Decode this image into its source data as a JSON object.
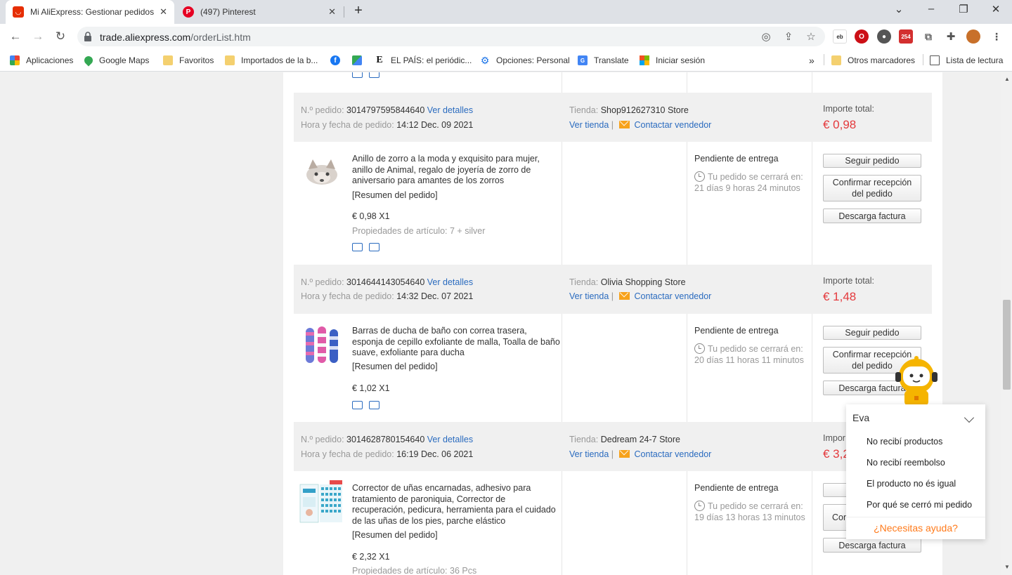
{
  "browser": {
    "tabs": [
      {
        "title": "Mi AliExpress: Gestionar pedidos",
        "icon": "aliexpress-icon",
        "active": true
      },
      {
        "title": "(497) Pinterest",
        "icon": "pinterest-icon",
        "active": false
      }
    ],
    "url_domain": "trade.aliexpress.com",
    "url_path": "/orderList.htm",
    "extension_badge": "254",
    "bookmarks": [
      {
        "label": "Aplicaciones",
        "icon": "apps-grid-icon"
      },
      {
        "label": "Google Maps",
        "icon": "google-maps-icon"
      },
      {
        "label": "Favoritos",
        "icon": "folder-icon"
      },
      {
        "label": "Importados de la b...",
        "icon": "folder-icon"
      },
      {
        "label": "",
        "icon": "facebook-icon"
      },
      {
        "label": "",
        "icon": "maps-icon"
      },
      {
        "label": "EL PAÍS: el periódic...",
        "icon": "el-pais-icon"
      },
      {
        "label": "Opciones: Personal",
        "icon": "gear-icon"
      },
      {
        "label": "Translate",
        "icon": "translate-icon"
      },
      {
        "label": "Iniciar sesión",
        "icon": "microsoft-icon"
      }
    ],
    "bookmarks_overflow": "»",
    "other_bookmarks": "Otros marcadores",
    "reading_list": "Lista de lectura"
  },
  "labels": {
    "order_no": "N.º pedido:",
    "details": "Ver detalles",
    "datetime": "Hora y fecha de pedido:",
    "store": "Tienda:",
    "view_store": "Ver tienda",
    "separator": "|",
    "contact_seller": "Contactar vendedor",
    "total": "Importe total:",
    "summary": "[Resumen del pedido]",
    "props_prefix": "Propiedades de artículo:",
    "pending": "Pendiente de entrega",
    "track": "Seguir pedido",
    "confirm": "Confirmar recepción del pedido",
    "invoice": "Descarga factura"
  },
  "orders": [
    {
      "number": "3014797595844640",
      "datetime": "14:12 Dec. 09 2021",
      "store": "Shop912627310 Store",
      "total": "€ 0,98",
      "title": "Anillo de zorro a la moda y exquisito para mujer, anillo de Animal, regalo de joyería de zorro de aniversario para amantes de los zorros",
      "price": "€ 0,98 X1",
      "props": "7 + silver",
      "closing": "Tu pedido se cerrará en: 21 días 9 horas 24 minutos"
    },
    {
      "number": "3014644143054640",
      "datetime": "14:32 Dec. 07 2021",
      "store": "Olivia Shopping Store",
      "total": "€ 1,48",
      "title": "Barras de ducha de baño con correa trasera, esponja de cepillo exfoliante de malla, Toalla de baño suave, exfoliante para ducha",
      "price": "€ 1,02 X1",
      "props": "",
      "closing": "Tu pedido se cerrará en: 20 días 11 horas 11 minutos"
    },
    {
      "number": "3014628780154640",
      "datetime": "16:19 Dec. 06 2021",
      "store": "Dedream 24-7 Store",
      "total": "€ 3,2",
      "title": "Corrector de uñas encarnadas, adhesivo para tratamiento de paroniquia, Corrector de recuperación, pedicura, herramienta para el cuidado de las uñas de los pies, parche elástico",
      "price": "€ 2,32 X1",
      "props": "36 Pcs",
      "closing": "Tu pedido se cerrará en: 19 días 13 horas 13 minutos",
      "total_label_visible": "Impor",
      "confirm_visible": "Con"
    }
  ],
  "chat": {
    "name": "Eva",
    "options": [
      "No recibí productos",
      "No recibí reembolso",
      "El producto no és igual",
      "Por qué se cerró mi pedido"
    ],
    "help": "¿Necesitas ayuda?"
  },
  "colors": {
    "link": "#2a6bbf",
    "price": "#e4393c",
    "help": "#ff7a1a",
    "mail": "#f7a21b"
  }
}
